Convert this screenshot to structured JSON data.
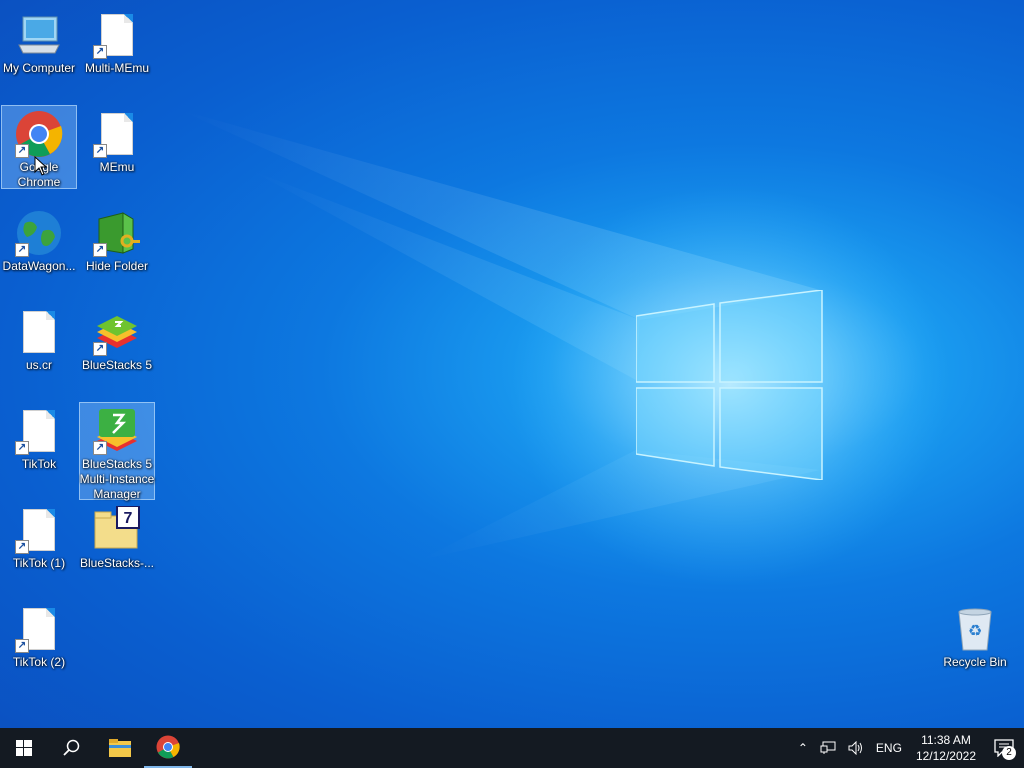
{
  "desktop": {
    "icons": [
      {
        "label": "My Computer",
        "icon": "computer-icon"
      },
      {
        "label": "Multi-MEmu",
        "icon": "file-icon"
      },
      {
        "label": "Google Chrome",
        "icon": "chrome-icon"
      },
      {
        "label": "MEmu",
        "icon": "file-icon"
      },
      {
        "label": "DataWagon...",
        "icon": "globe-icon"
      },
      {
        "label": "Hide Folder",
        "icon": "hide-folder-icon"
      },
      {
        "label": "us.cr",
        "icon": "file-icon"
      },
      {
        "label": "BlueStacks 5",
        "icon": "bluestacks-icon"
      },
      {
        "label": "TikTok",
        "icon": "file-icon"
      },
      {
        "label": "BlueStacks 5 Multi-Instance Manager",
        "icon": "bluestacks-multi-icon"
      },
      {
        "label": "TikTok (1)",
        "icon": "file-icon"
      },
      {
        "label": "BlueStacks-...",
        "icon": "7zip-archive-icon"
      },
      {
        "label": "TikTok (2)",
        "icon": "file-icon"
      }
    ],
    "recycle_bin": {
      "label": "Recycle Bin"
    }
  },
  "taskbar": {
    "language": "ENG",
    "time": "11:38 AM",
    "date": "12/12/2022",
    "notification_count": "2"
  },
  "colors": {
    "accent": "#0a6fd8",
    "taskbar": "#141a22"
  }
}
